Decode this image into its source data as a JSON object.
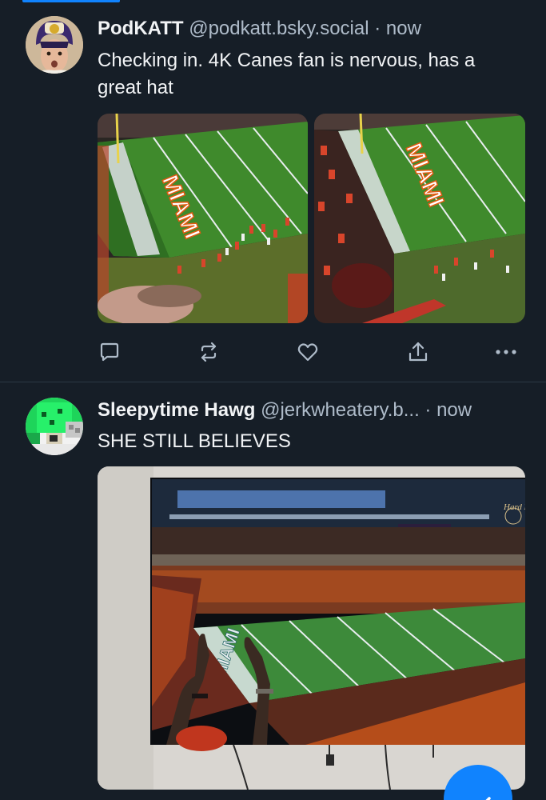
{
  "posts": [
    {
      "author": {
        "display_name": "PodKATT",
        "handle": "@podkatt.bsky.social",
        "avatar_icon": "avatar-player-in-helmet"
      },
      "separator": "·",
      "timestamp": "now",
      "text": "Checking in. 4K Canes fan is nervous, has a great hat",
      "images": [
        {
          "end_zone_text": "MIAMI",
          "icon": "stadium-end-zone-photo"
        },
        {
          "end_zone_text": "MIAMI",
          "icon": "stadium-end-zone-photo"
        }
      ],
      "actions": [
        "reply-icon",
        "repost-icon",
        "like-icon",
        "share-icon",
        "more-icon"
      ]
    },
    {
      "author": {
        "display_name": "Sleepytime Hawg",
        "handle": "@jerkwheatery.b...",
        "avatar_icon": "avatar-green-pixel-art"
      },
      "separator": "·",
      "timestamp": "now",
      "text": "SHE STILL BELIEVES",
      "images": [
        {
          "end_zone_text": "MIAMI",
          "icon": "tv-stadium-photo"
        }
      ]
    }
  ],
  "colors": {
    "background": "#161e27",
    "divider": "#2c3845",
    "secondary_text": "#aebbc9",
    "icon": "#aebbc9",
    "accent": "#1083fe"
  },
  "fab": {
    "icon": "compose-icon"
  }
}
